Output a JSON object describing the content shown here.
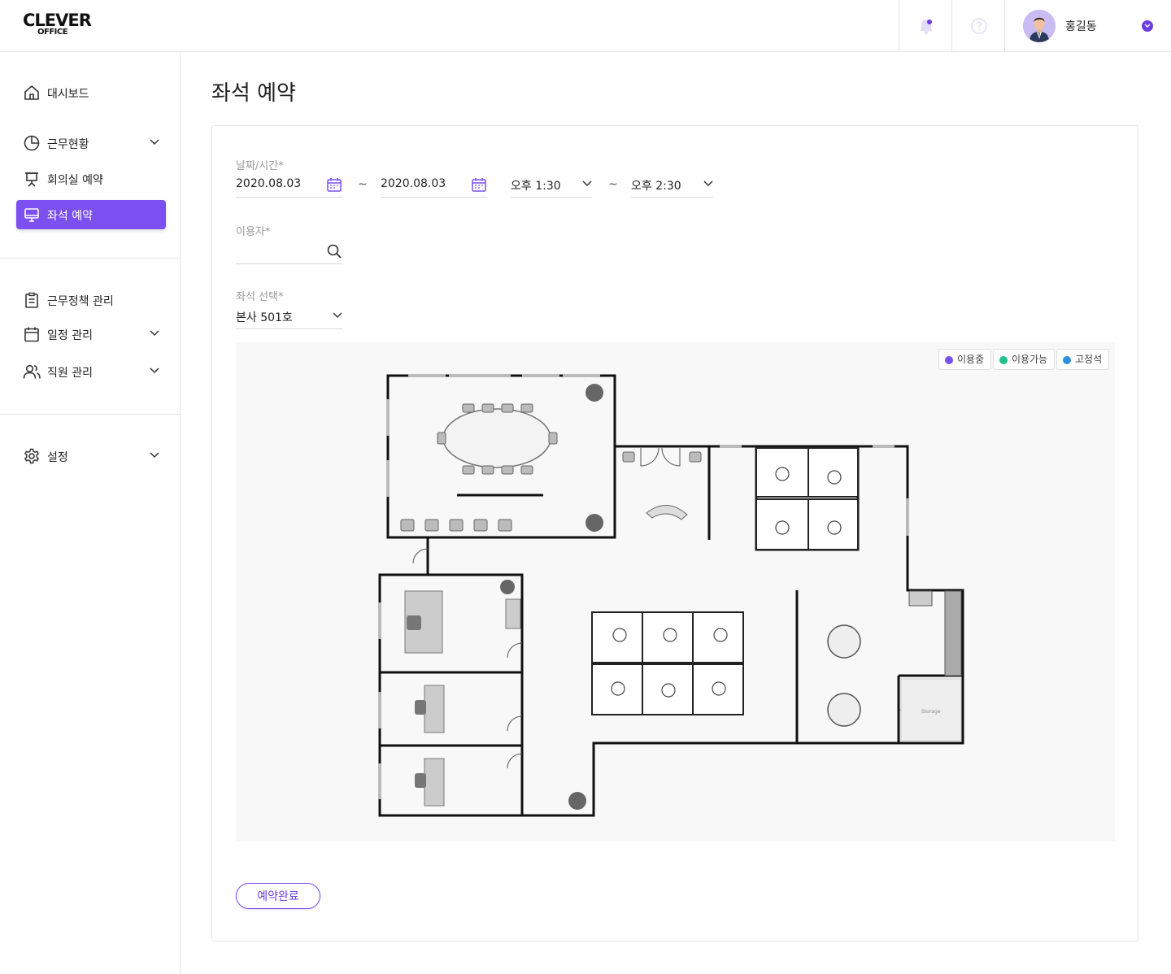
{
  "app": {
    "logo_line1": "CLEVER",
    "logo_line2": "OFFICE"
  },
  "header": {
    "user_name": "홍길동"
  },
  "sidebar": {
    "items": [
      {
        "label": "대시보드"
      },
      {
        "label": "근무현황"
      },
      {
        "label": "회의실 예약"
      },
      {
        "label": "좌석 예약"
      },
      {
        "label": "근무정책 관리"
      },
      {
        "label": "일정 관리"
      },
      {
        "label": "직원 관리"
      },
      {
        "label": "설정"
      }
    ]
  },
  "page": {
    "title": "좌석 예약"
  },
  "form": {
    "datetime_label": "날짜/시간*",
    "start_date": "2020.08.03",
    "end_date": "2020.08.03",
    "range_sep": "~",
    "start_time": "오후 1:30",
    "end_time": "오후 2:30",
    "user_label": "이용자*",
    "user_value": "",
    "seat_label": "좌석 선택*",
    "seat_value": "본사 501호"
  },
  "legend": [
    {
      "label": "이용중",
      "color": "#7b4ff0"
    },
    {
      "label": "이용가능",
      "color": "#1fc28b"
    },
    {
      "label": "고정석",
      "color": "#2f8ee0"
    }
  ],
  "floorplan": {
    "storage_label": "Storage"
  },
  "actions": {
    "submit_label": "예약완료"
  },
  "colors": {
    "accent": "#7b4ff0"
  }
}
